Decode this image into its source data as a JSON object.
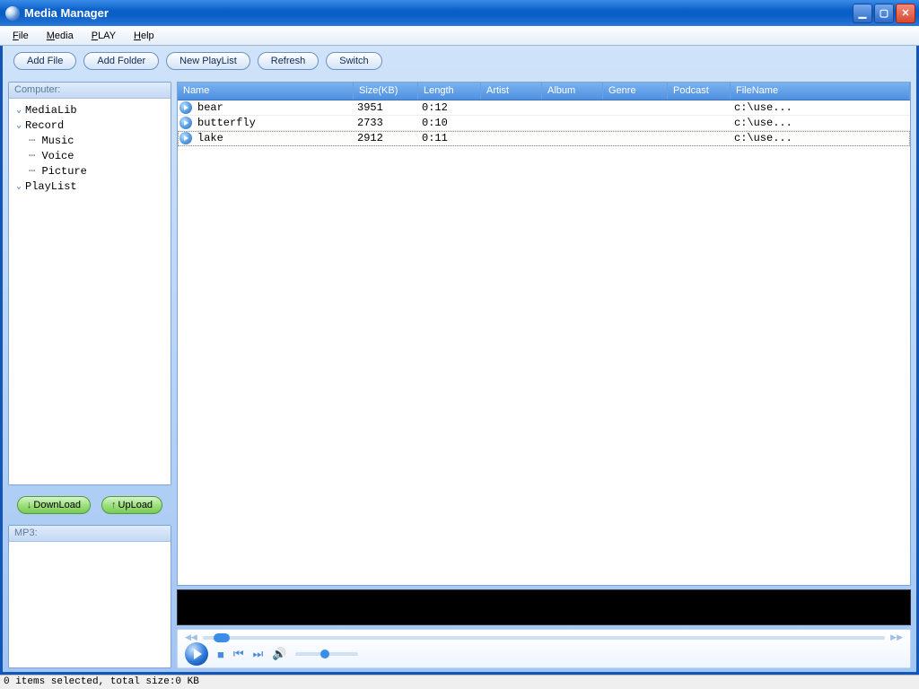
{
  "window": {
    "title": "Media Manager"
  },
  "menu": {
    "file": "File",
    "media": "Media",
    "play": "PLAY",
    "help": "Help"
  },
  "toolbar": {
    "add_file": "Add File",
    "add_folder": "Add Folder",
    "new_playlist": "New PlayList",
    "refresh": "Refresh",
    "switch": "Switch"
  },
  "tree": {
    "header": "Computer:",
    "medialib": "MediaLib",
    "record": "Record",
    "music": "Music",
    "voice": "Voice",
    "picture": "Picture",
    "playlist": "PlayList"
  },
  "actions": {
    "download": "DownLoad",
    "upload": "UpLoad"
  },
  "mp3_panel": {
    "header": "MP3:"
  },
  "columns": {
    "name": "Name",
    "size": "Size(KB)",
    "length": "Length",
    "artist": "Artist",
    "album": "Album",
    "genre": "Genre",
    "podcast": "Podcast",
    "filename": "FileName"
  },
  "rows": [
    {
      "name": "bear",
      "size": "3951",
      "length": "0:12",
      "artist": "",
      "album": "",
      "genre": "",
      "podcast": "",
      "filename": "c:\\use..."
    },
    {
      "name": "butterfly",
      "size": "2733",
      "length": "0:10",
      "artist": "",
      "album": "",
      "genre": "",
      "podcast": "",
      "filename": "c:\\use..."
    },
    {
      "name": "lake",
      "size": "2912",
      "length": "0:11",
      "artist": "",
      "album": "",
      "genre": "",
      "podcast": "",
      "filename": "c:\\use..."
    }
  ],
  "status": "0 items selected, total size:0 KB"
}
